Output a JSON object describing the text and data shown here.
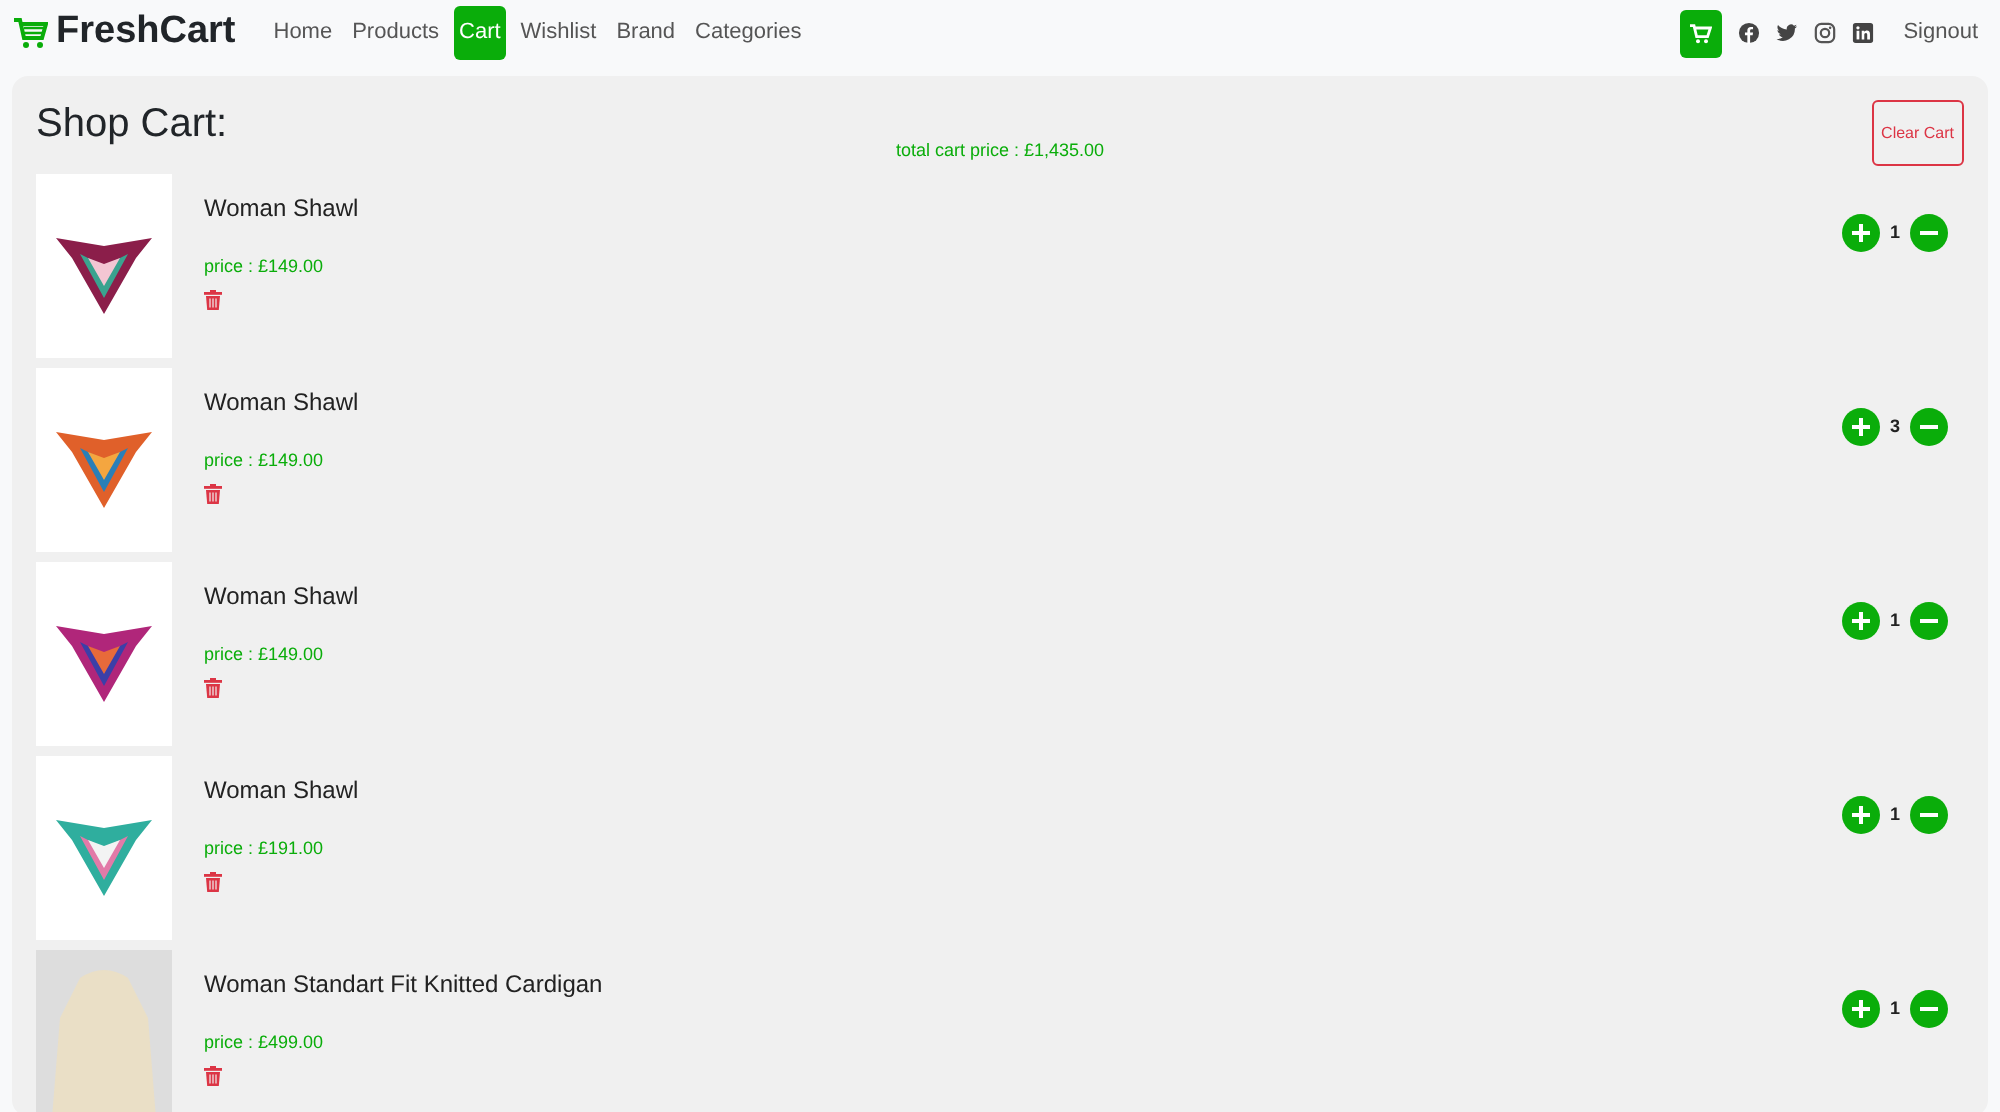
{
  "navbar": {
    "brand": "FreshCart",
    "links": [
      {
        "label": "Home",
        "selected": false
      },
      {
        "label": "Products",
        "selected": false
      },
      {
        "label": "Cart",
        "selected": true
      },
      {
        "label": "Wishlist",
        "selected": false
      },
      {
        "label": "Brand",
        "selected": false
      },
      {
        "label": "Categories",
        "selected": false
      }
    ],
    "signout": "Signout"
  },
  "cart": {
    "title": "Shop Cart:",
    "clear_button": "Clear Cart",
    "total": "total cart price : £1,435.00",
    "items": [
      {
        "name": "Woman Shawl",
        "price": "price : £149.00",
        "quantity": "1"
      },
      {
        "name": "Woman Shawl",
        "price": "price : £149.00",
        "quantity": "3"
      },
      {
        "name": "Woman Shawl",
        "price": "price : £149.00",
        "quantity": "1"
      },
      {
        "name": "Woman Shawl",
        "price": "price : £191.00",
        "quantity": "1"
      },
      {
        "name": "Woman Standart Fit Knitted Cardigan",
        "price": "price : £499.00",
        "quantity": "1"
      }
    ]
  }
}
